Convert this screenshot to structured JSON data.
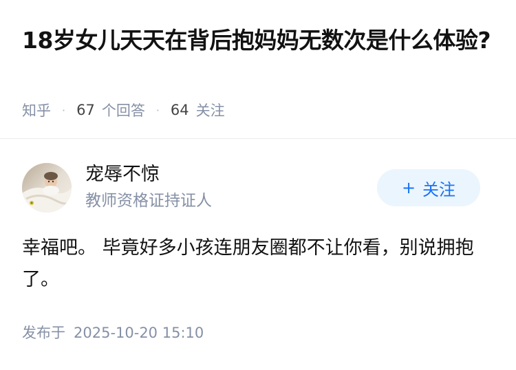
{
  "question": {
    "title": "18岁女儿天天在背后抱妈妈无数次是什么体验?",
    "source": "知乎",
    "answer_count": "67",
    "answer_label": "个回答",
    "follow_count": "64",
    "follow_label": "关注",
    "separator": "·"
  },
  "answer": {
    "author": {
      "name": "宠辱不惊",
      "badge": "教师资格证持证人",
      "avatar_icon": "avatar-photo"
    },
    "follow_button": {
      "icon": "plus-icon",
      "icon_glyph": "+",
      "label": "关注"
    },
    "content": "幸福吧。 毕竟好多小孩连朋友圈都不让你看，别说拥抱了。",
    "published_label": "发布于",
    "published_time": "2025-10-20 15:10"
  },
  "colors": {
    "accent": "#1772f6",
    "accent_bg": "#ebf5fd",
    "meta": "#8590a6",
    "text": "#121212"
  }
}
